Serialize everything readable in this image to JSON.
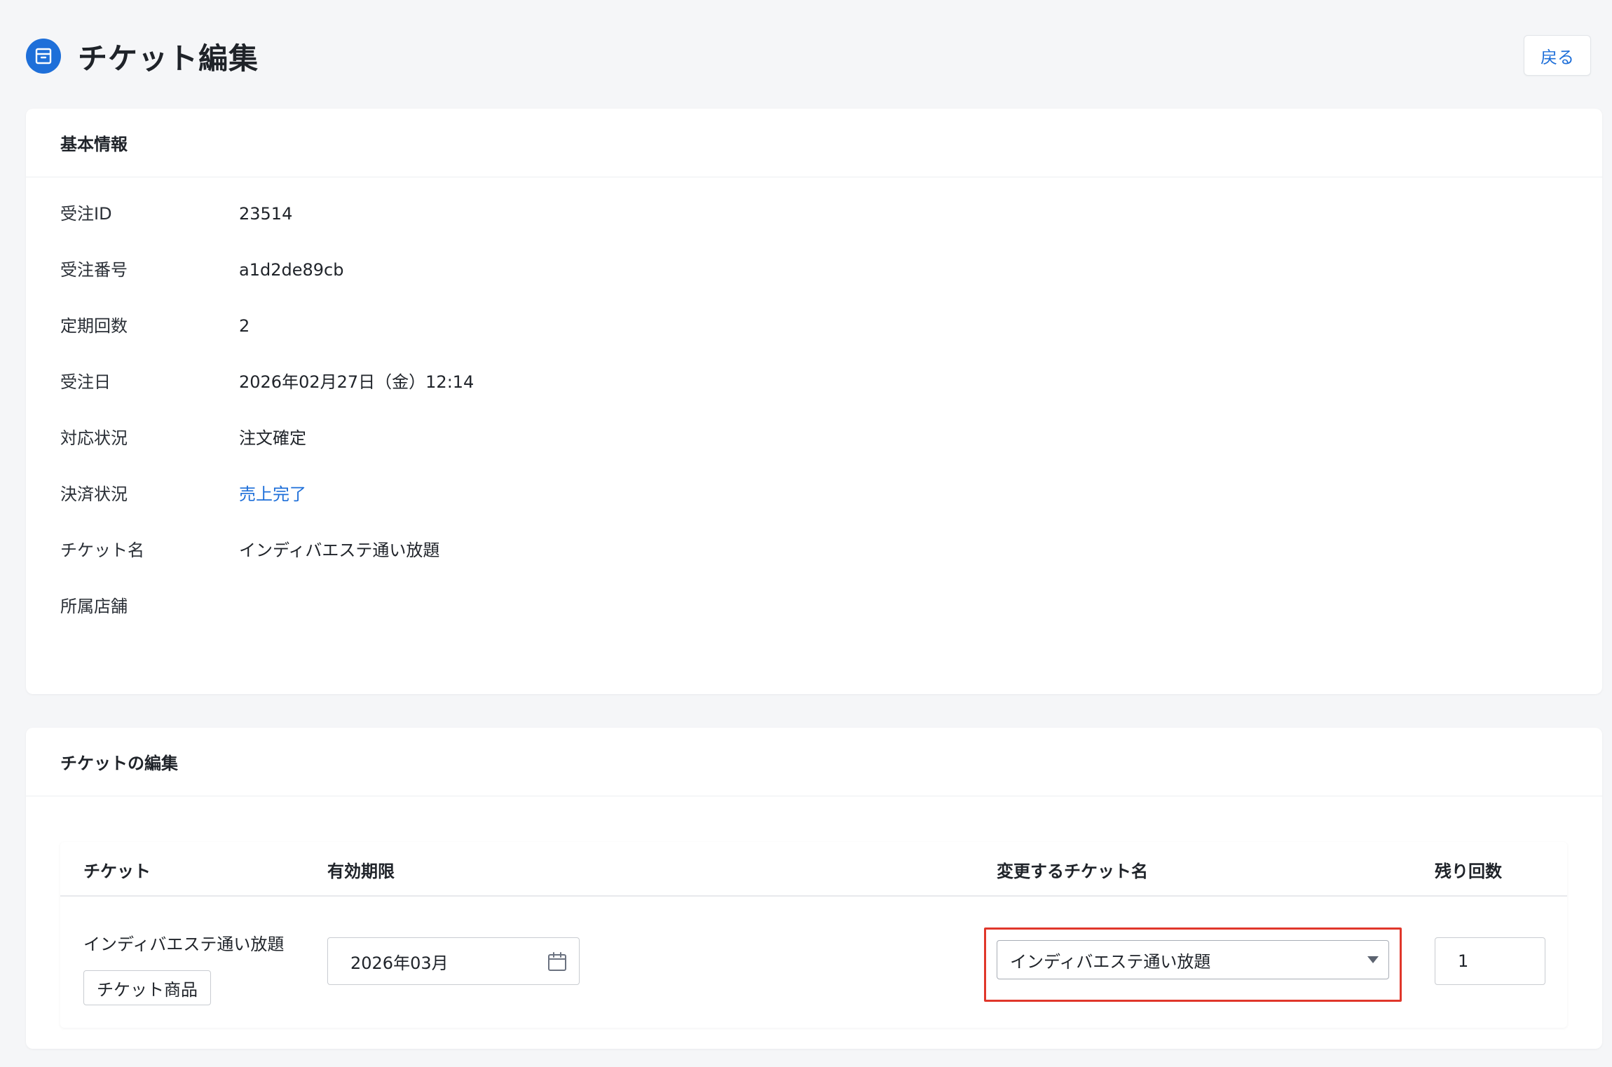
{
  "header": {
    "title": "チケット編集",
    "back_label": "戻る"
  },
  "basic_info": {
    "section_title": "基本情報",
    "rows": [
      {
        "label": "受注ID",
        "value": "23514"
      },
      {
        "label": "受注番号",
        "value": "a1d2de89cb"
      },
      {
        "label": "定期回数",
        "value": "2"
      },
      {
        "label": "受注日",
        "value": "2026年02月27日（金）12:14"
      },
      {
        "label": "対応状況",
        "value": "注文確定"
      },
      {
        "label": "決済状況",
        "value": "売上完了"
      },
      {
        "label": "チケット名",
        "value": "インディバエステ通い放題"
      },
      {
        "label": "所属店舗",
        "value": ""
      }
    ]
  },
  "ticket_edit": {
    "section_title": "チケットの編集",
    "columns": {
      "ticket": "チケット",
      "expiry": "有効期限",
      "new_name": "変更するチケット名",
      "remaining": "残り回数"
    },
    "row": {
      "ticket_name": "インディバエステ通い放題",
      "ticket_tag": "チケット商品",
      "expiry_value": "2026年03月",
      "selected_name": "インディバエステ通い放題",
      "remaining_value": "1"
    }
  },
  "colors": {
    "accent": "#1e6fd9",
    "highlight": "#e0372b",
    "background": "#f5f6f8"
  },
  "icons": {
    "title": "ticket-box-icon",
    "calendar": "calendar-icon",
    "select": "caret-down-icon"
  }
}
